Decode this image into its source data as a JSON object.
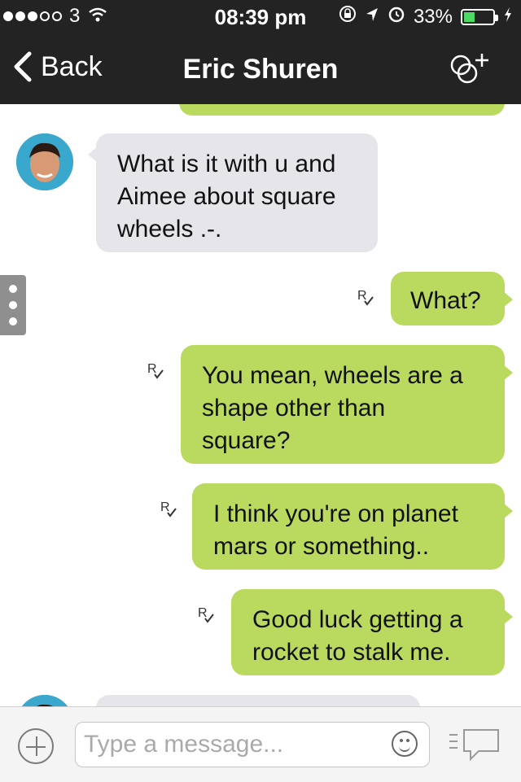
{
  "status_bar": {
    "carrier": "3",
    "time": "08:39 pm",
    "battery": "33%",
    "battery_level": 0.33
  },
  "nav": {
    "back_label": "Back",
    "title": "Eric Shuren"
  },
  "messages": [
    {
      "direction": "in",
      "text_lines": [
        "What is it with u and",
        "Aimee about square",
        "wheels .-."
      ]
    },
    {
      "direction": "out",
      "receipt": "R",
      "text_lines": [
        "What?"
      ]
    },
    {
      "direction": "out",
      "receipt": "R",
      "text_lines": [
        "You mean, wheels are a",
        "shape other than",
        "square?"
      ]
    },
    {
      "direction": "out",
      "receipt": "R",
      "text_lines": [
        "I think you're on planet",
        "mars or something.."
      ]
    },
    {
      "direction": "out",
      "receipt": "R",
      "text_lines": [
        "Good luck getting a",
        "rocket to stalk me."
      ]
    }
  ],
  "composer": {
    "placeholder": "Type a message..."
  },
  "colors": {
    "outgoing_bubble": "#bada5f",
    "incoming_bubble": "#e5e5ea",
    "header": "#232323"
  }
}
